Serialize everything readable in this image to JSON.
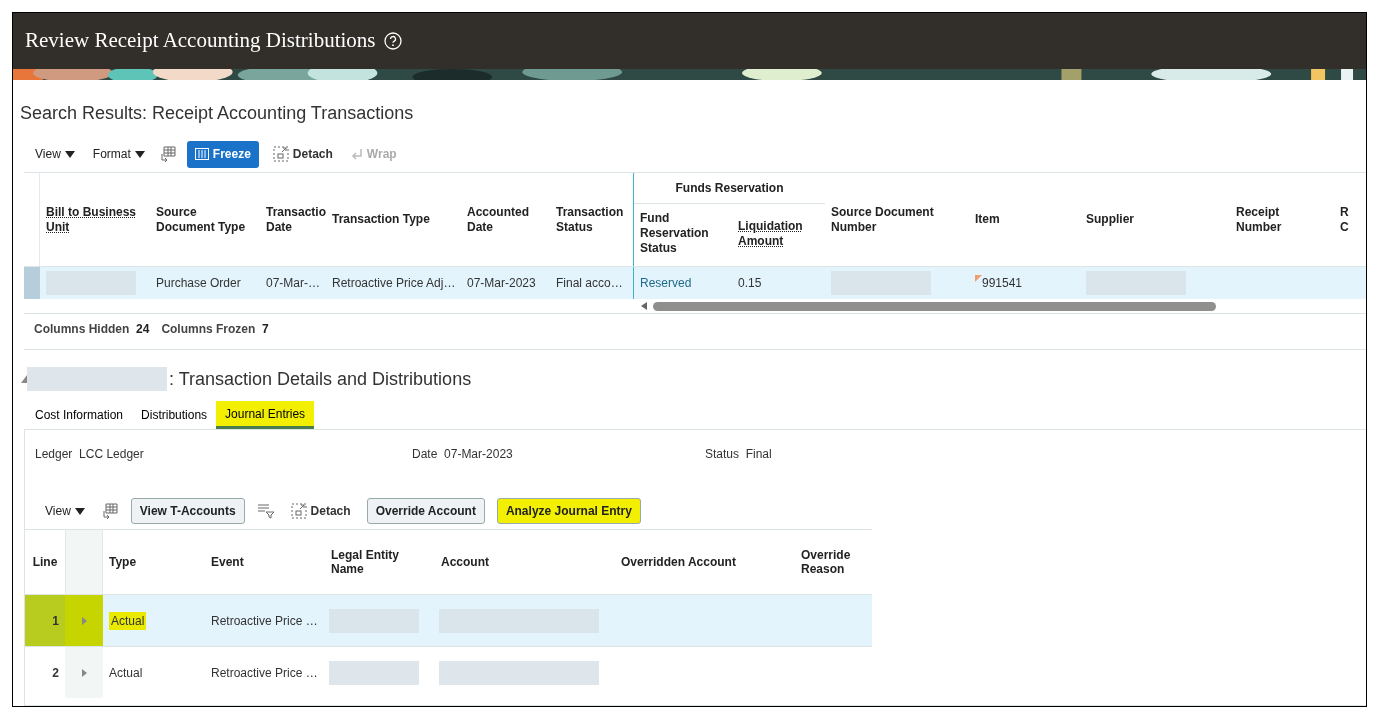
{
  "page": {
    "title": "Review Receipt Accounting Distributions"
  },
  "search_results": {
    "title": "Search Results: Receipt Accounting Transactions",
    "toolbar": [
      {
        "kind": "menu",
        "label": "View"
      },
      {
        "kind": "menu",
        "label": "Format"
      },
      {
        "kind": "icon"
      },
      {
        "kind": "primary",
        "label": "Freeze"
      },
      {
        "kind": "detach",
        "label": "Detach"
      },
      {
        "kind": "wrap",
        "label": "Wrap",
        "disabled": true
      }
    ],
    "group_header": "Funds Reservation",
    "columns": [
      {
        "label": "Bill to Business Unit",
        "help": true,
        "group": false
      },
      {
        "label": "Source Document Type",
        "help": false,
        "group": false
      },
      {
        "label": "Transactio Date",
        "help": false,
        "group": false
      },
      {
        "label": "Transaction Type",
        "help": false,
        "group": false
      },
      {
        "label": "Accounted Date",
        "help": false,
        "group": false
      },
      {
        "label": "Transaction Status",
        "help": false,
        "group": false
      },
      {
        "label": "Fund Reservation Status",
        "help": false,
        "group": true
      },
      {
        "label": "Liquidation Amount",
        "help": true,
        "group": true
      },
      {
        "label": "Source Document Number",
        "help": false,
        "group": false
      },
      {
        "label": "Item",
        "help": false,
        "group": false
      },
      {
        "label": "Supplier",
        "help": false,
        "group": false
      },
      {
        "label": "Receipt Number",
        "help": false,
        "group": false
      },
      {
        "label": "R C",
        "help": false,
        "group": false
      }
    ],
    "rows": [
      {
        "selected": true,
        "cells": [
          {
            "kind": "redacted"
          },
          {
            "kind": "text",
            "text": "Purchase Order"
          },
          {
            "kind": "text",
            "text": "07-Mar-…"
          },
          {
            "kind": "text",
            "text": "Retroactive Price Adj…"
          },
          {
            "kind": "text",
            "text": "07-Mar-2023"
          },
          {
            "kind": "text",
            "text": "Final acco…"
          },
          {
            "kind": "link",
            "text": "Reserved"
          },
          {
            "kind": "text",
            "text": "0.15"
          },
          {
            "kind": "redacted"
          },
          {
            "kind": "flagged",
            "text": "991541"
          },
          {
            "kind": "redacted"
          },
          {
            "kind": "blank"
          },
          {
            "kind": "blank"
          }
        ]
      }
    ],
    "footer": [
      {
        "label": "Columns Hidden",
        "value": "24"
      },
      {
        "label": "Columns Frozen",
        "value": "7"
      }
    ]
  },
  "details": {
    "title": ": Transaction Details and Distributions",
    "tabs": [
      {
        "label": "Cost Information",
        "selected": false,
        "highlighted": false
      },
      {
        "label": "Distributions",
        "selected": false,
        "highlighted": false
      },
      {
        "label": "Journal Entries",
        "selected": true,
        "highlighted": true
      }
    ],
    "fields": [
      {
        "label": "Ledger",
        "value": "LCC Ledger"
      },
      {
        "label": "Date",
        "value": "07-Mar-2023"
      },
      {
        "label": "Status",
        "value": "Final"
      }
    ],
    "toolbar": [
      {
        "kind": "menu",
        "label": "View"
      },
      {
        "kind": "icon"
      },
      {
        "kind": "button",
        "label": "View T-Accounts",
        "highlighted": false
      },
      {
        "kind": "filter"
      },
      {
        "kind": "detach",
        "label": "Detach"
      },
      {
        "kind": "button",
        "label": "Override Account",
        "highlighted": false
      },
      {
        "kind": "button",
        "label": "Analyze Journal Entry",
        "highlighted": true
      }
    ],
    "columns": [
      "Line",
      "Type",
      "Event",
      "Legal Entity Name",
      "Account",
      "Overridden Account",
      "Override Reason"
    ],
    "rows": [
      {
        "line": "1",
        "type": "Actual",
        "event": "Retroactive Price …",
        "selected": true,
        "highlighted": true
      },
      {
        "line": "2",
        "type": "Actual",
        "event": "Retroactive Price …",
        "selected": false,
        "highlighted": false
      }
    ]
  }
}
